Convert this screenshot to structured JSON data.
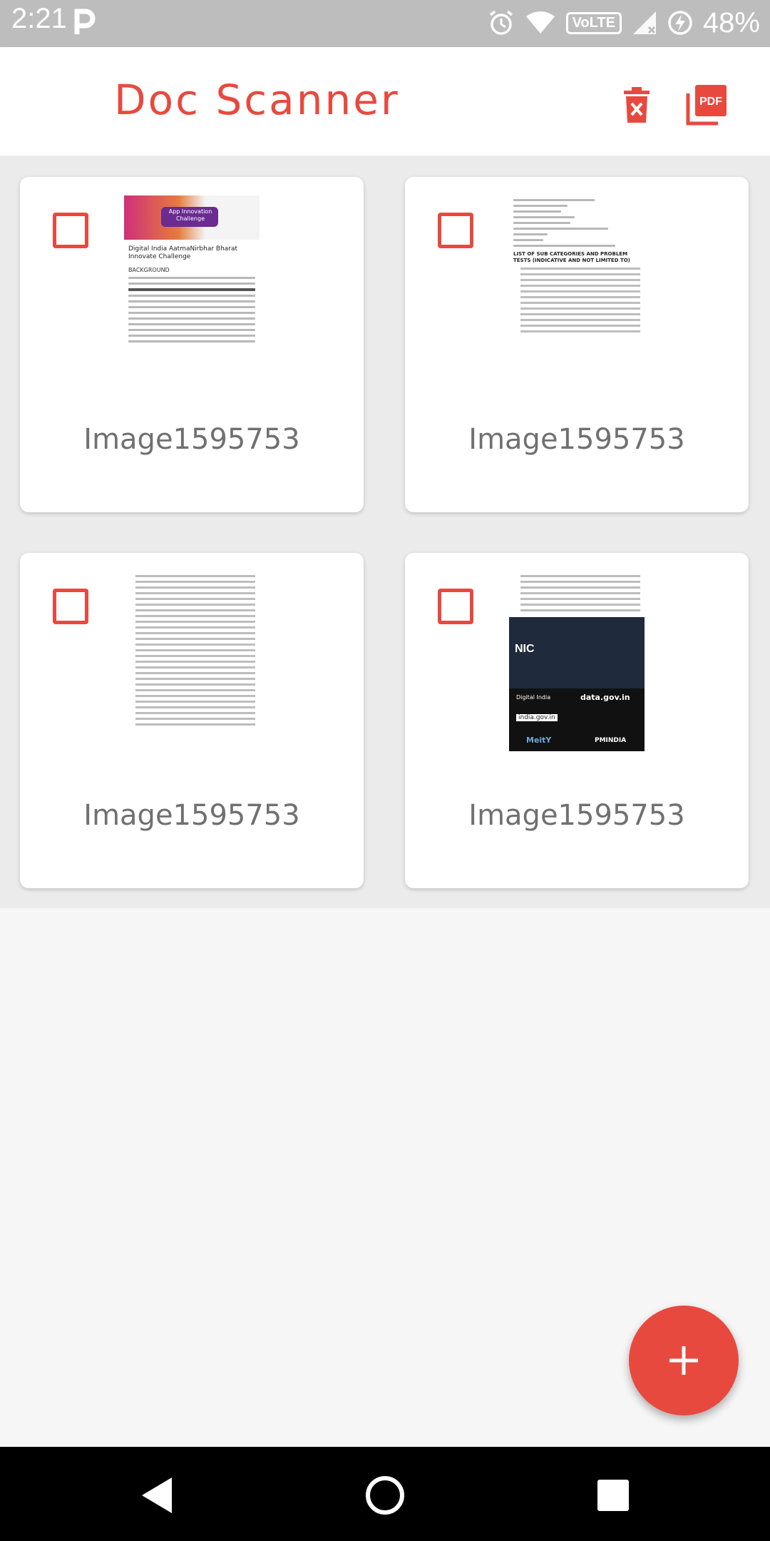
{
  "status_bar": {
    "time": "2:21",
    "volte": "VoLTE",
    "battery": "48%"
  },
  "app_bar": {
    "title": "Doc Scanner",
    "delete_icon": "delete-icon",
    "pdf_icon": "pdf-icon",
    "pdf_text": "PDF"
  },
  "documents": [
    {
      "name": "Image1595753",
      "selected": false,
      "thumb_heading": "Digital India AatmaNirbhar Bharat Innovate Challenge",
      "thumb_section": "BACKGROUND",
      "banner_text": "App Innovation Challenge"
    },
    {
      "name": "Image1595753",
      "selected": false,
      "thumb_heading": "LIST OF SUB CATEGORIES AND PROBLEM TESTS (INDICATIVE AND NOT LIMITED TO)"
    },
    {
      "name": "Image1595753",
      "selected": false
    },
    {
      "name": "Image1595753",
      "selected": false,
      "thumb_logos": [
        "NIC",
        "Digital India",
        "data.gov.in",
        "india.gov.in",
        "MeitY",
        "PMINDIA"
      ]
    }
  ],
  "fab": {
    "icon": "plus-icon"
  },
  "nav": {
    "back": "back-icon",
    "home": "home-icon",
    "recents": "recents-icon"
  },
  "colors": {
    "accent": "#e8493f",
    "status_bar": "#bdbdbd",
    "nav_bar": "#000000"
  }
}
